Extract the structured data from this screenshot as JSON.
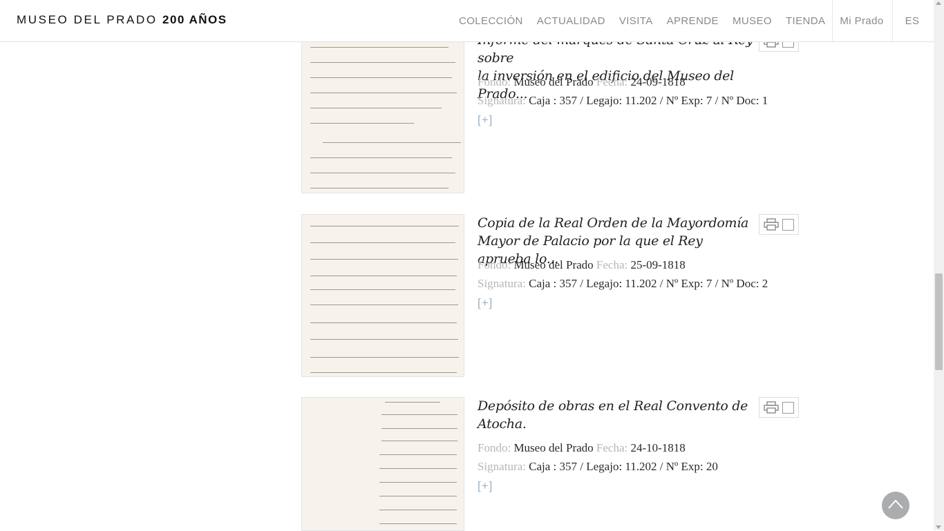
{
  "header": {
    "logo_text": "MUSEO DEL PRADO",
    "logo_bold": "200 AÑOS",
    "nav": [
      "COLECCIÓN",
      "ACTUALIDAD",
      "VISITA",
      "APRENDE",
      "MUSEO",
      "TIENDA"
    ],
    "mi_prado": "Mi Prado",
    "language": "ES"
  },
  "labels": {
    "fondo": "Fondo:",
    "fecha": "Fecha:",
    "signatura": "Signatura:",
    "more": "[+]"
  },
  "results": [
    {
      "title_line1": "Informe del marqués de Santa Cruz al Rey sobre",
      "title_line2": "la inversión en el edificio del Museo del Prado...",
      "fondo": "Museo del Prado",
      "fecha": "24-09-1818",
      "signatura": "Caja : 357 / Legajo: 11.202 / Nº Exp: 7 / Nº Doc: 1"
    },
    {
      "title_line1": "Copia de la Real Orden de la Mayordomía",
      "title_line2": "Mayor de Palacio por la que el Rey aprueba lo...",
      "fondo": "Museo del Prado",
      "fecha": "25-09-1818",
      "signatura": "Caja : 357 / Legajo: 11.202 / Nº Exp: 7 / Nº Doc: 2"
    },
    {
      "title_line1": "Depósito de obras en el Real Convento de",
      "title_line2": "Atocha.",
      "fondo": "Museo del Prado",
      "fecha": "24-10-1818",
      "signatura": "Caja : 357 / Legajo: 11.202 / Nº Exp: 20"
    }
  ],
  "icons": {
    "print": "print-icon",
    "select": "checkbox-icon",
    "back_to_top": "chevron-up-icon"
  }
}
